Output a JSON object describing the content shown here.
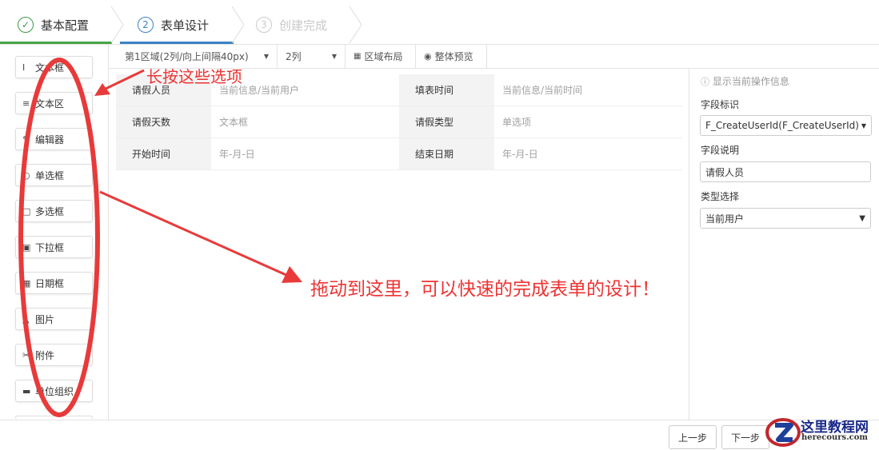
{
  "steps": [
    {
      "num": "✓",
      "label": "基本配置"
    },
    {
      "num": "2",
      "label": "表单设计"
    },
    {
      "num": "3",
      "label": "创建完成"
    }
  ],
  "sidebar": {
    "items": [
      {
        "icon": "I",
        "label": "文本框"
      },
      {
        "icon": "≡",
        "label": "文本区"
      },
      {
        "icon": "✎",
        "label": "编辑器"
      },
      {
        "icon": "○",
        "label": "单选框"
      },
      {
        "icon": "□",
        "label": "多选框"
      },
      {
        "icon": "▣",
        "label": "下拉框"
      },
      {
        "icon": "▦",
        "label": "日期框"
      },
      {
        "icon": "▲",
        "label": "图片"
      },
      {
        "icon": "✂",
        "label": "附件"
      },
      {
        "icon": "▬",
        "label": "单位组织"
      }
    ]
  },
  "toolbar": {
    "region": "第1区域(2列/向上间隔40px)",
    "columns": "2列",
    "layout": "区域布局",
    "preview": "整体预览"
  },
  "form": {
    "rows": [
      [
        {
          "label": "请假人员",
          "value": "当前信息/当前用户"
        },
        {
          "label": "填表时间",
          "value": "当前信息/当前时间"
        }
      ],
      [
        {
          "label": "请假天数",
          "value": "文本框"
        },
        {
          "label": "请假类型",
          "value": "单选项"
        }
      ],
      [
        {
          "label": "开始时间",
          "value": "年-月-日"
        },
        {
          "label": "结束日期",
          "value": "年-月-日"
        }
      ]
    ]
  },
  "panel": {
    "info": "显示当前操作信息",
    "field_id_label": "字段标识",
    "field_id_value": "F_CreateUserId(F_CreateUserId)",
    "field_desc_label": "字段说明",
    "field_desc_value": "请假人员",
    "type_label": "类型选择",
    "type_value": "当前用户"
  },
  "buttons": {
    "prev": "上一步",
    "next": "下一步"
  },
  "annotations": {
    "top": "长按这些选项",
    "middle": "拖动到这里，可以快速的完成表单的设计！",
    "color": "#e83a3a"
  },
  "watermark": {
    "title": "这里教程网",
    "url": "herecours.com"
  }
}
